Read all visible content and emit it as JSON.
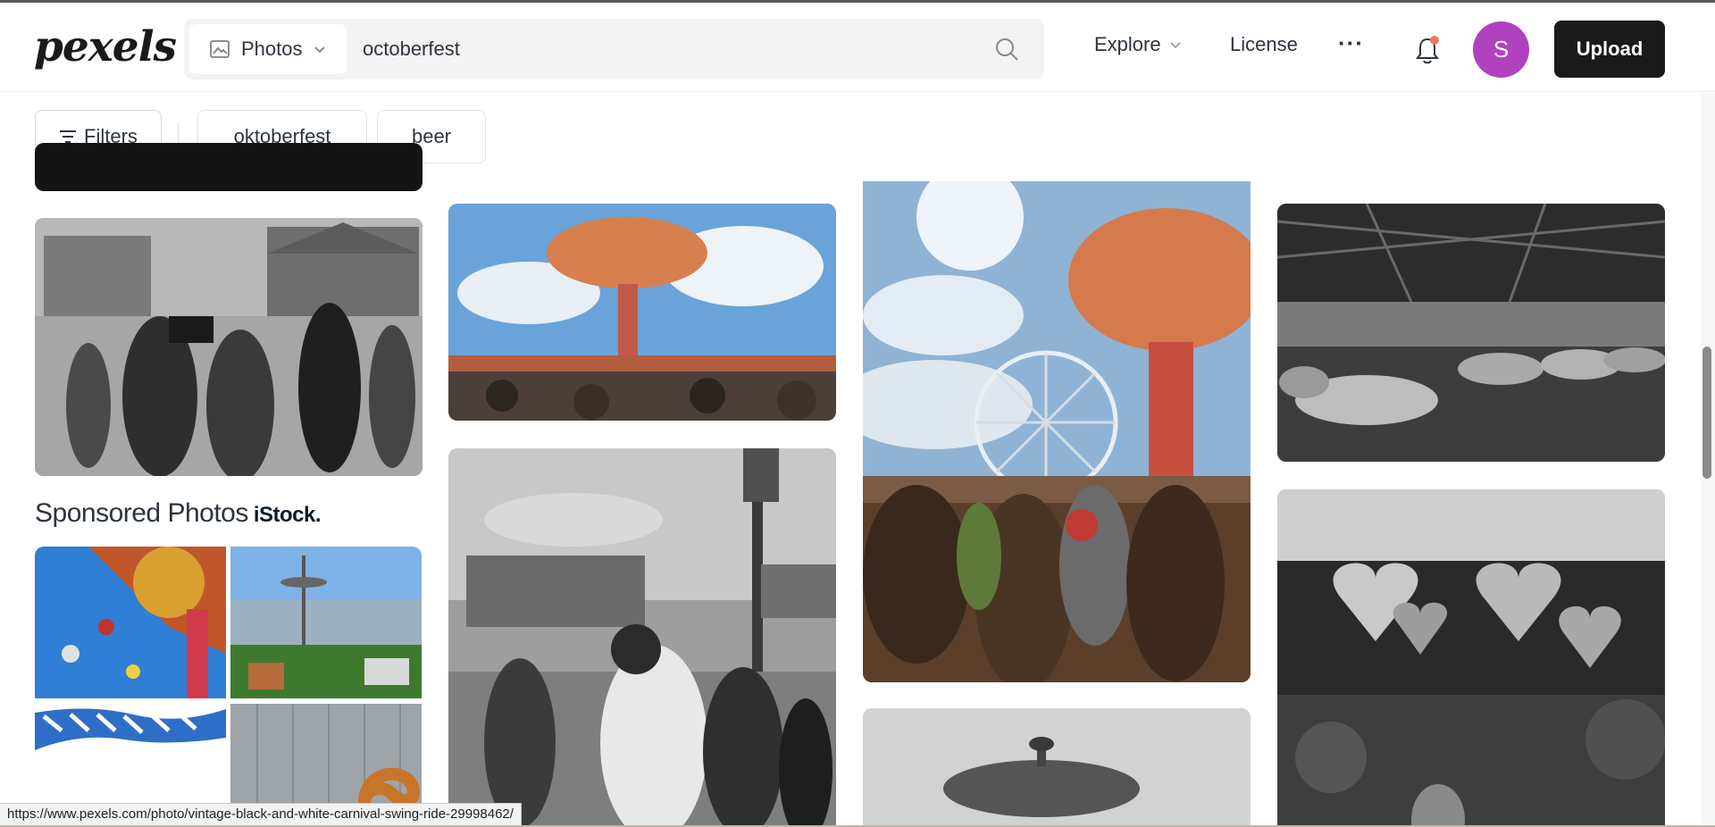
{
  "header": {
    "logo": "pexels",
    "media_type": "Photos",
    "search_value": "octoberfest",
    "nav": {
      "explore": "Explore",
      "license": "License",
      "more": "···"
    },
    "avatar_initial": "S",
    "upload_label": "Upload"
  },
  "filters": {
    "filters_label": "Filters",
    "chips": [
      "oktoberfest",
      "beer"
    ]
  },
  "sponsored": {
    "title": "Sponsored Photos",
    "brand": "iStock."
  },
  "status_bar": {
    "url": "https://www.pexels.com/photo/vintage-black-and-white-carnival-swing-ride-29998462/"
  },
  "colors": {
    "avatar": "#b042bf",
    "upload": "#1a1a1a",
    "notification_dot": "#f0775b"
  }
}
